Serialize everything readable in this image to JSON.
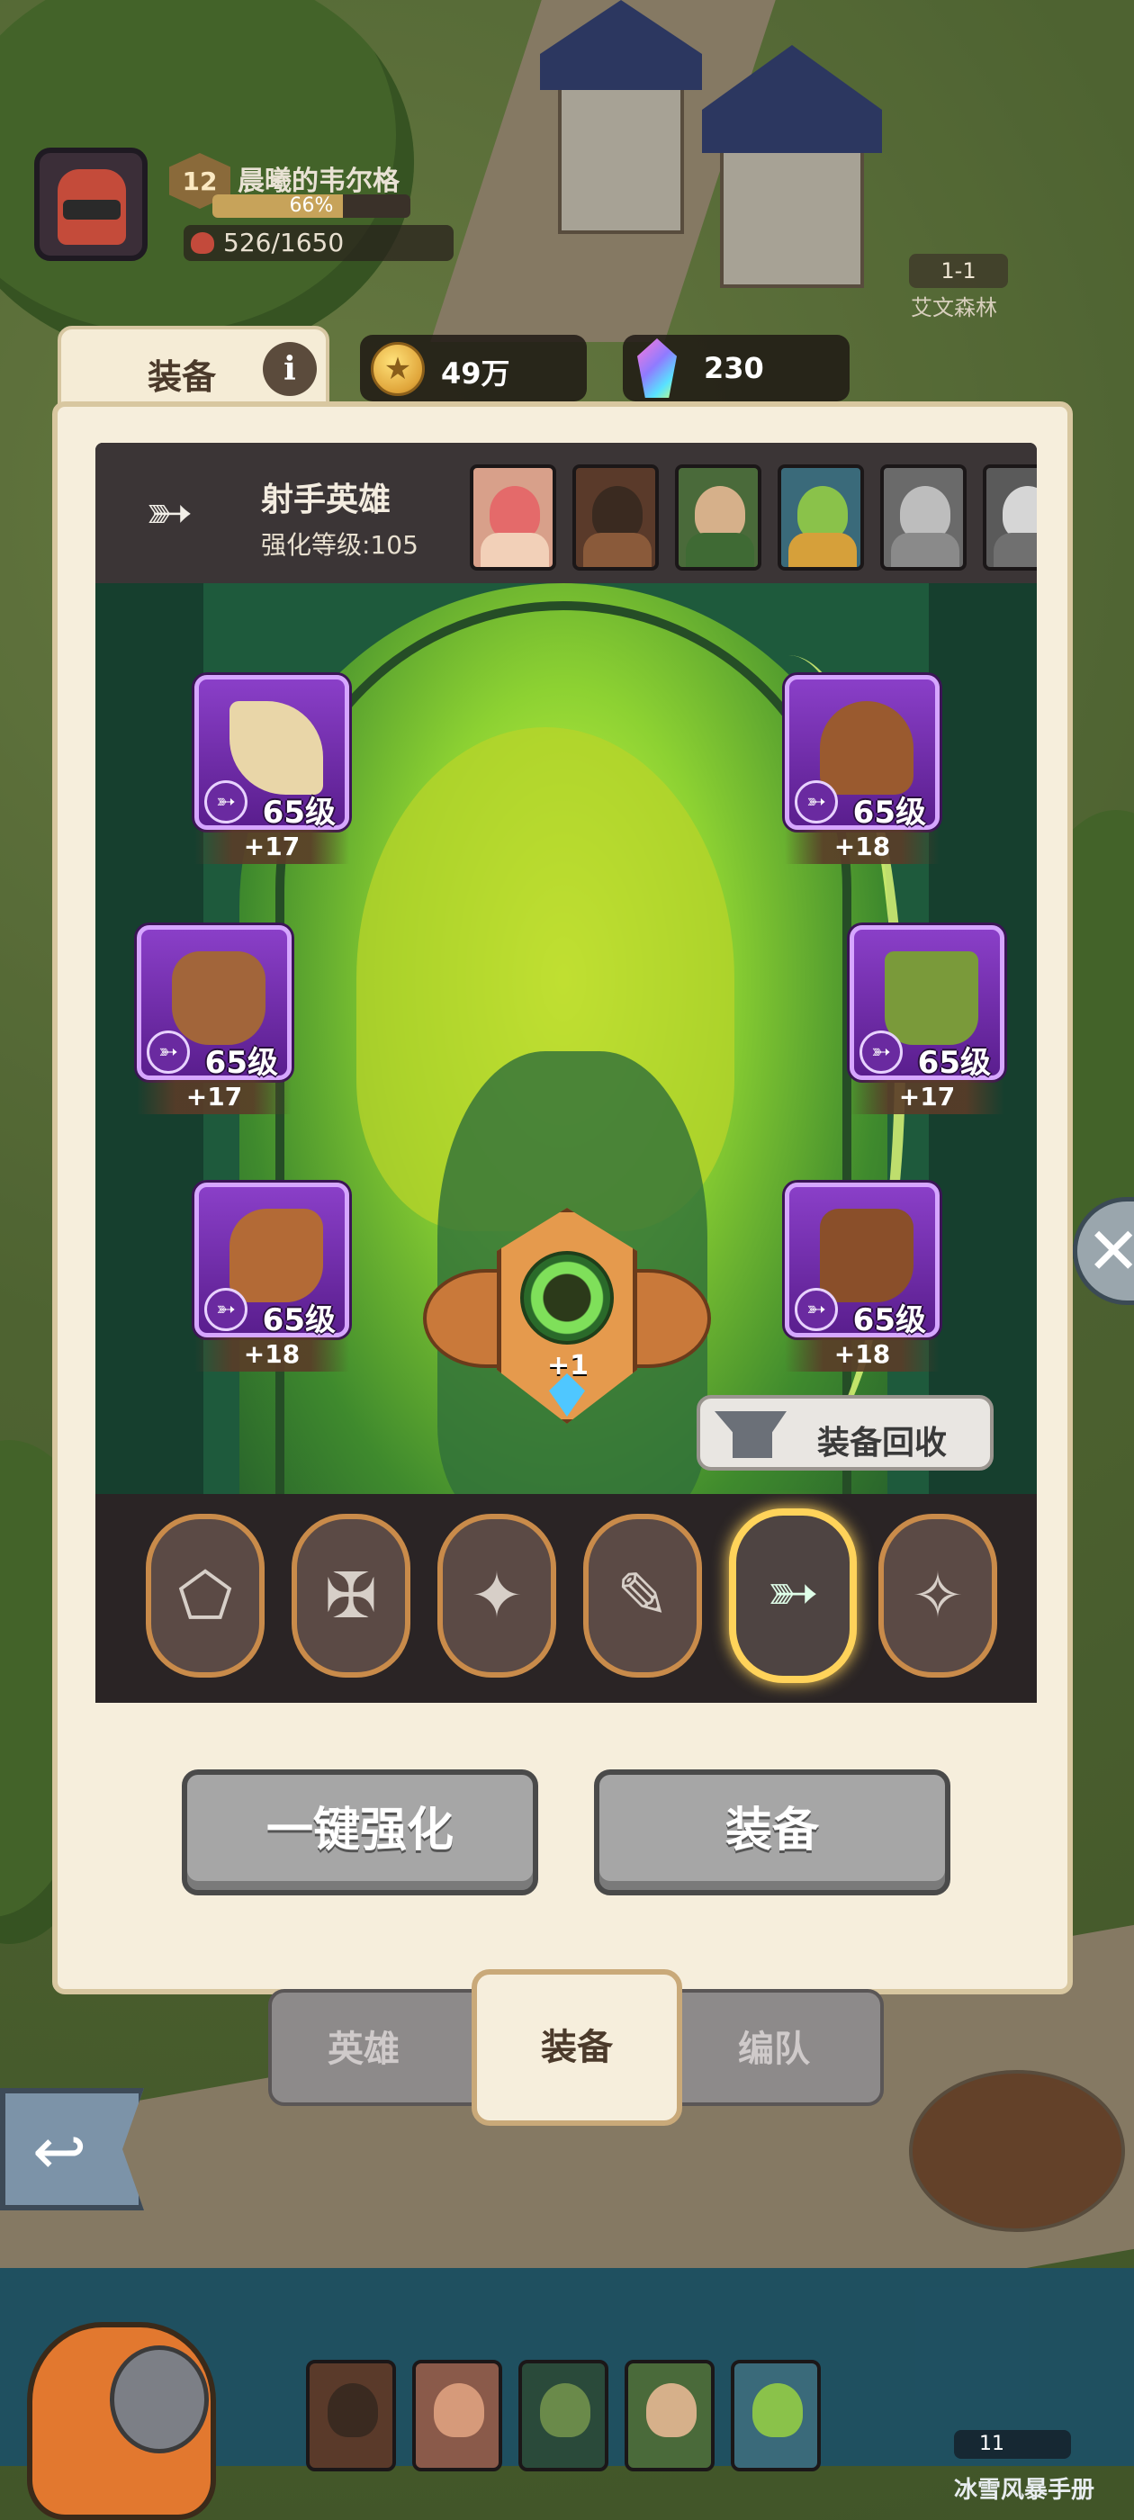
{
  "player": {
    "level": "12",
    "name": "晨曦的韦尔格",
    "xp_percent": 66,
    "xp_text": "66%",
    "stamina": "526/1650"
  },
  "stage": {
    "label": "1-1",
    "place": "艾文森林"
  },
  "tab_title": {
    "label": "装备",
    "info_icon": "i"
  },
  "currency": {
    "gold": "49万",
    "gems": "230"
  },
  "hero_class": {
    "name": "射手英雄",
    "enhance_level": "强化等级:105"
  },
  "equipment_slots": [
    {
      "item": "feather-arrows-icon",
      "level": "65级",
      "plus": "+17",
      "color": "#e9d6a8"
    },
    {
      "item": "leather-helmet-icon",
      "level": "65级",
      "plus": "+18",
      "color": "#9a5a2f"
    },
    {
      "item": "leaf-armor-icon",
      "level": "65级",
      "plus": "+17",
      "color": "#a2653a"
    },
    {
      "item": "belt-pants-icon",
      "level": "65级",
      "plus": "+17",
      "color": "#7a9a3a"
    },
    {
      "item": "bracer-icon",
      "level": "65级",
      "plus": "+18",
      "color": "#b36a36"
    },
    {
      "item": "boots-icon",
      "level": "65级",
      "plus": "+18",
      "color": "#8a4f2a"
    }
  ],
  "amulet": {
    "plus": "+1"
  },
  "recycle_button": "装备回收",
  "class_filters": [
    {
      "icon": "shield-icon",
      "glyph": "⬠",
      "active": false
    },
    {
      "icon": "axe-icon",
      "glyph": "✠",
      "active": false
    },
    {
      "icon": "shuriken-icon",
      "glyph": "✦",
      "active": false
    },
    {
      "icon": "staff-icon",
      "glyph": "✎",
      "active": false
    },
    {
      "icon": "bow-icon",
      "glyph": "➳",
      "active": true
    },
    {
      "icon": "healer-icon",
      "glyph": "✧",
      "active": false
    }
  ],
  "buttons": {
    "enhance_all": "一键强化",
    "equip": "装备"
  },
  "bottom_tabs": {
    "heroes": "英雄",
    "equipment": "装备",
    "formation": "编队"
  },
  "bottom_status": {
    "count": "11",
    "handbook": "冰雪风暴手册"
  },
  "colors": {
    "panel_bg": "#f6eedc",
    "epic_purple": "#8a3fc8",
    "gold_border": "#ffd35a"
  }
}
